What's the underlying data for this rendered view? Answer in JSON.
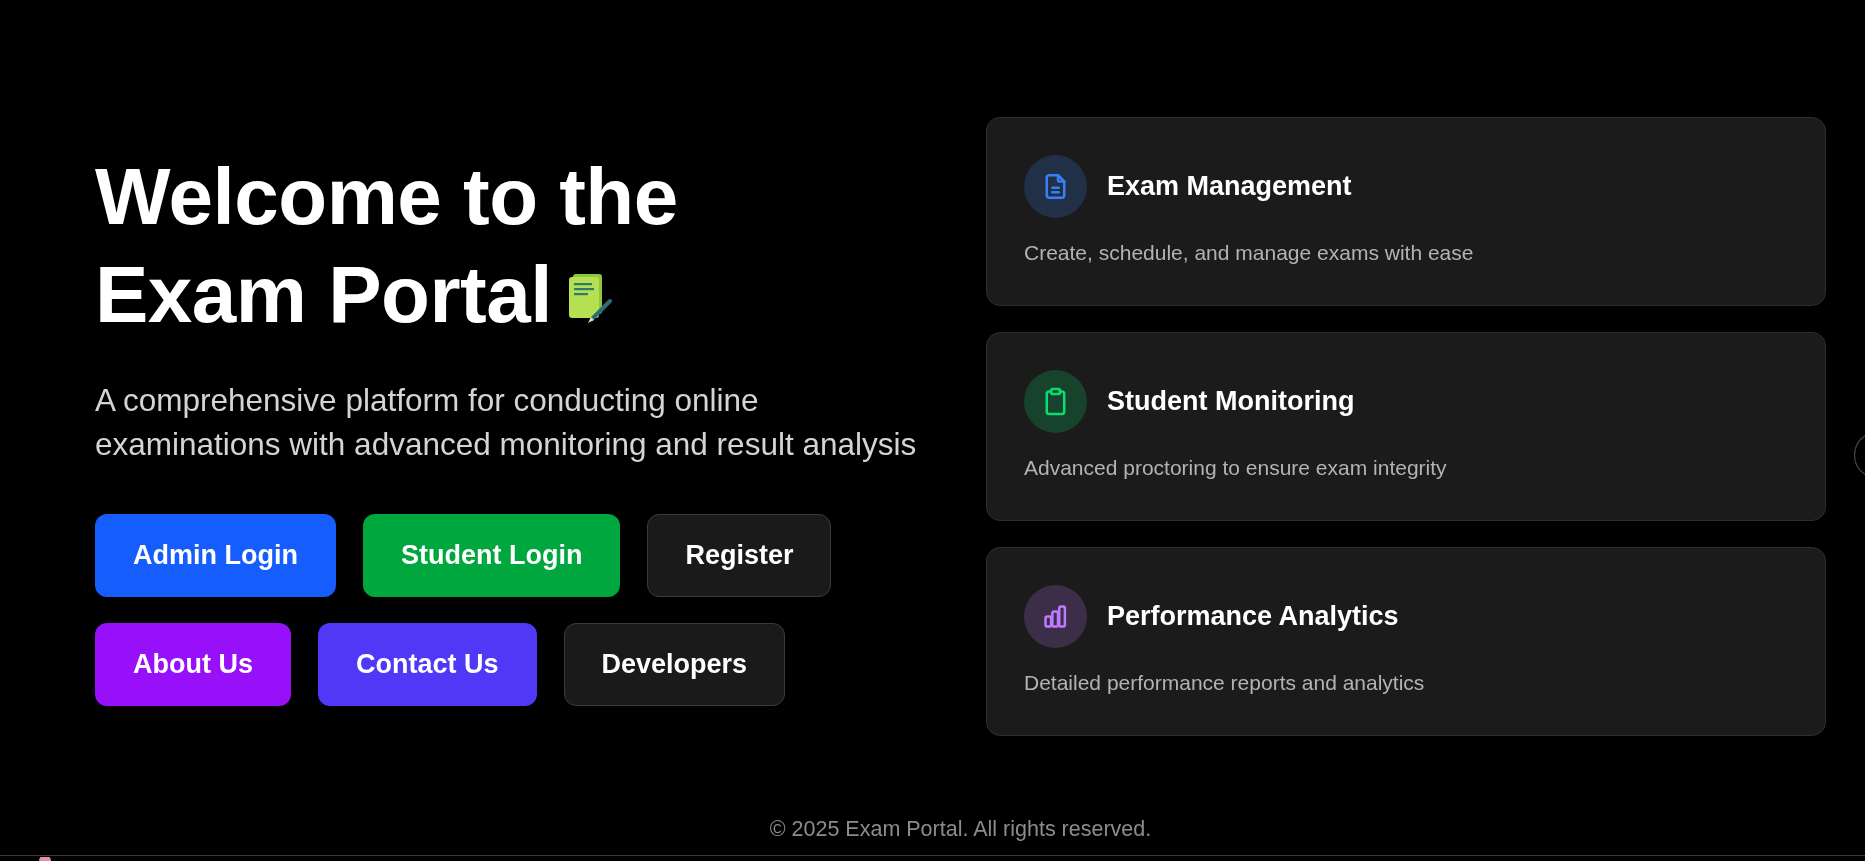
{
  "hero": {
    "title_lines": [
      "Welcome to the",
      "Exam Portal"
    ],
    "subtitle": "A comprehensive platform for conducting online examinations with advanced monitoring and result analysis",
    "button_rows": [
      [
        {
          "label": "Admin Login",
          "kind": "filled",
          "color": "#155dfc"
        },
        {
          "label": "Student Login",
          "kind": "filled",
          "color": "#00a63e"
        },
        {
          "label": "Register",
          "kind": "outline"
        }
      ],
      [
        {
          "label": "About Us",
          "kind": "filled",
          "color": "#9810fa"
        },
        {
          "label": "Contact Us",
          "kind": "filled",
          "color": "#4f39f6"
        },
        {
          "label": "Developers",
          "kind": "outline"
        }
      ]
    ]
  },
  "features": [
    {
      "title": "Exam Management",
      "description": "Create, schedule, and manage exams with ease",
      "color": "#212f47"
    },
    {
      "title": "Student Monitoring",
      "description": "Advanced proctoring to ensure exam integrity",
      "color": "#17422c"
    },
    {
      "title": "Performance Analytics",
      "description": "Detailed performance reports and analytics",
      "color": "#3c2e49"
    }
  ],
  "footer": {
    "copyright": "© 2025 Exam Portal. All rights reserved."
  }
}
